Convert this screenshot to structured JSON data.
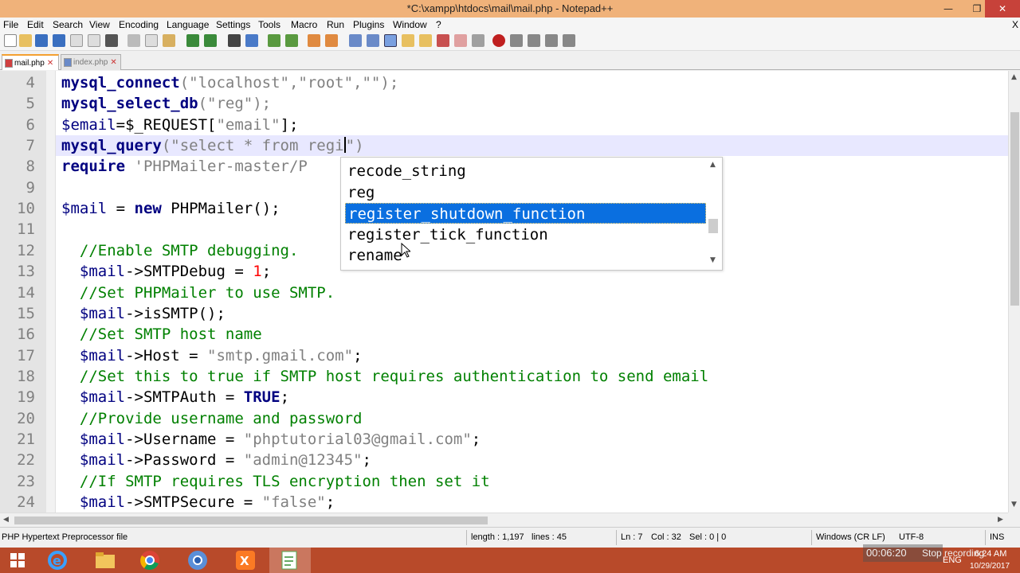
{
  "window": {
    "title": "*C:\\xampp\\htdocs\\mail\\mail.php - Notepad++"
  },
  "controls": {
    "minimize": "—",
    "maximize": "❐",
    "close": "✕"
  },
  "menu": [
    "File",
    "Edit",
    "Search",
    "View",
    "Encoding",
    "Language",
    "Settings",
    "Tools",
    "Macro",
    "Run",
    "Plugins",
    "Window",
    "?"
  ],
  "menu_close": "X",
  "tabs": [
    {
      "label": "mail.php",
      "active": true
    },
    {
      "label": "index.php",
      "active": false
    }
  ],
  "editor": {
    "lines": [
      {
        "num": "4",
        "tokens": [
          [
            "kw",
            "mysql_connect"
          ],
          [
            "str",
            "(\"localhost\",\"root\",\"\");"
          ]
        ]
      },
      {
        "num": "5",
        "tokens": [
          [
            "kw",
            "mysql_select_db"
          ],
          [
            "str",
            "(\"reg\");"
          ]
        ]
      },
      {
        "num": "6",
        "tokens": [
          [
            "var",
            "$email"
          ],
          [
            "txt",
            "=$_REQUEST["
          ],
          [
            "str",
            "\"email\""
          ],
          [
            "txt",
            "];"
          ]
        ]
      },
      {
        "num": "7",
        "tokens": [
          [
            "kw",
            "mysql_query"
          ],
          [
            "str",
            "(\"select * from regi"
          ],
          [
            "caret",
            ""
          ],
          [
            "str",
            "\")"
          ]
        ]
      },
      {
        "num": "8",
        "tokens": [
          [
            "kw",
            "require"
          ],
          [
            "str",
            " 'PHPMailer-master/P"
          ]
        ]
      },
      {
        "num": "9",
        "tokens": []
      },
      {
        "num": "10",
        "tokens": [
          [
            "var",
            "$mail"
          ],
          [
            "txt",
            " = "
          ],
          [
            "kw",
            "new"
          ],
          [
            "txt",
            " PHPMailer();"
          ]
        ]
      },
      {
        "num": "11",
        "tokens": []
      },
      {
        "num": "12",
        "tokens": [
          [
            "cm",
            "  //Enable SMTP debugging."
          ]
        ]
      },
      {
        "num": "13",
        "tokens": [
          [
            "var",
            "  $mail"
          ],
          [
            "txt",
            "->SMTPDebug = "
          ],
          [
            "num",
            "1"
          ],
          [
            "txt",
            ";"
          ]
        ]
      },
      {
        "num": "14",
        "tokens": [
          [
            "cm",
            "  //Set PHPMailer to use SMTP."
          ]
        ]
      },
      {
        "num": "15",
        "tokens": [
          [
            "var",
            "  $mail"
          ],
          [
            "txt",
            "->isSMTP();"
          ]
        ]
      },
      {
        "num": "16",
        "tokens": [
          [
            "cm",
            "  //Set SMTP host name"
          ]
        ]
      },
      {
        "num": "17",
        "tokens": [
          [
            "var",
            "  $mail"
          ],
          [
            "txt",
            "->Host = "
          ],
          [
            "str",
            "\"smtp.gmail.com\""
          ],
          [
            "txt",
            ";"
          ]
        ]
      },
      {
        "num": "18",
        "tokens": [
          [
            "cm",
            "  //Set this to true if SMTP host requires authentication to send email"
          ]
        ]
      },
      {
        "num": "19",
        "tokens": [
          [
            "var",
            "  $mail"
          ],
          [
            "txt",
            "->SMTPAuth = "
          ],
          [
            "kw",
            "TRUE"
          ],
          [
            "txt",
            ";"
          ]
        ]
      },
      {
        "num": "20",
        "tokens": [
          [
            "cm",
            "  //Provide username and password"
          ]
        ]
      },
      {
        "num": "21",
        "tokens": [
          [
            "var",
            "  $mail"
          ],
          [
            "txt",
            "->Username = "
          ],
          [
            "str",
            "\"phptutorial03@gmail.com\""
          ],
          [
            "txt",
            ";"
          ]
        ]
      },
      {
        "num": "22",
        "tokens": [
          [
            "var",
            "  $mail"
          ],
          [
            "txt",
            "->Password = "
          ],
          [
            "str",
            "\"admin@12345\""
          ],
          [
            "txt",
            ";"
          ]
        ]
      },
      {
        "num": "23",
        "tokens": [
          [
            "cm",
            "  //If SMTP requires TLS encryption then set it"
          ]
        ]
      },
      {
        "num": "24",
        "tokens": [
          [
            "var",
            "  $mail"
          ],
          [
            "txt",
            "->SMTPSecure = "
          ],
          [
            "str",
            "\"false\""
          ],
          [
            "txt",
            ";"
          ]
        ]
      }
    ]
  },
  "autocomplete": {
    "items": [
      "recode_string",
      "reg",
      "register_shutdown_function",
      "register_tick_function",
      "rename"
    ],
    "selected_index": 2
  },
  "status": {
    "file_type": "PHP Hypertext Preprocessor file",
    "length": "length : 1,197",
    "lines": "lines : 45",
    "ln": "Ln : 7",
    "col": "Col : 32",
    "sel": "Sel : 0 | 0",
    "eol": "Windows (CR LF)",
    "encoding": "UTF-8",
    "mode": "INS"
  },
  "taskbar": {
    "apps": [
      "windows-start",
      "internet-explorer",
      "file-explorer",
      "chrome",
      "chrome-alt",
      "xampp",
      "notepad-plus-plus"
    ],
    "lang": "ENG",
    "time": "6:24 AM",
    "date": "10/29/2017"
  },
  "recording": {
    "timer": "00:06:20",
    "label": "Stop recording"
  },
  "colors": {
    "titlebar": "#f0b27a",
    "taskbar": "#b84a2a",
    "selection": "#0a6fe0",
    "keyword": "#000080",
    "comment": "#008000",
    "string": "#808080"
  }
}
